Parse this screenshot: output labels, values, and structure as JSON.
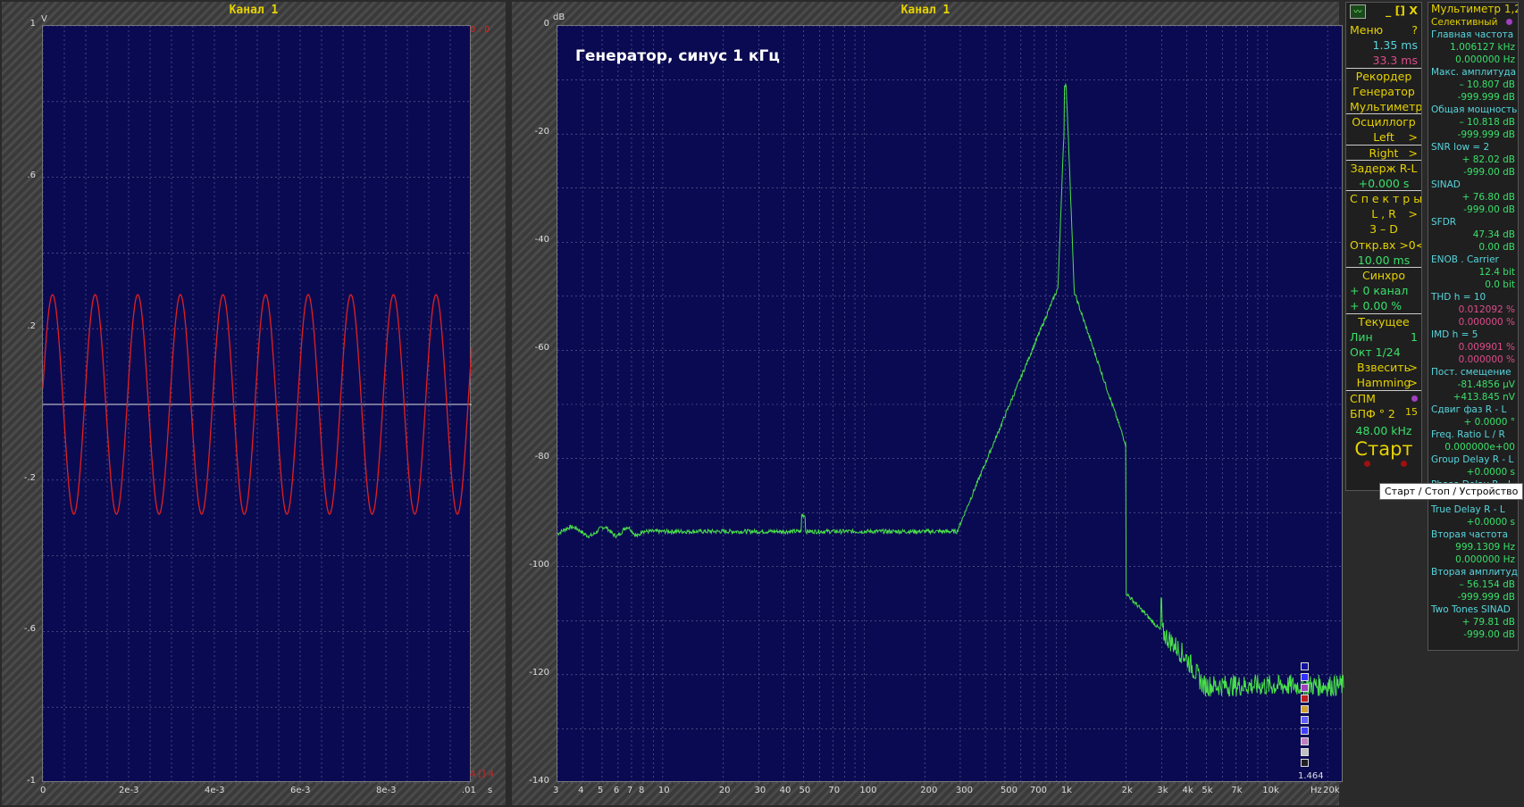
{
  "left_pane": {
    "title": "Канал 1",
    "unit_y": "V",
    "unit_x": "s",
    "y_ticks": [
      "1",
      ".6",
      ".2",
      "-.2",
      "-.6",
      "-1"
    ],
    "x_ticks": [
      "0",
      "2e-3",
      "4e-3",
      "6e-3",
      "8e-3",
      ".01"
    ],
    "corner_top": "0 : 0",
    "corner_bottom": "4 [] 4"
  },
  "right_pane": {
    "title": "Канал 1",
    "unit_y": "dB",
    "unit_x": "Hz",
    "annotation": "Генератор, синус 1 кГц",
    "scale_value": "1.464",
    "y_ticks": [
      "0",
      "-20",
      "-40",
      "-60",
      "-80",
      "-100",
      "-120",
      "-140"
    ],
    "x_ticks": [
      "3",
      "4",
      "5",
      "6",
      "7",
      "8",
      "10",
      "20",
      "30",
      "40",
      "50",
      "70",
      "100",
      "200",
      "300",
      "500",
      "700",
      "1k",
      "2k",
      "3k",
      "4k",
      "5k",
      "7k",
      "10k",
      "20k"
    ]
  },
  "menu": {
    "win_buttons": "_ [] X",
    "menu_label": "Меню",
    "help": "?",
    "t1": "1.35 ms",
    "t2": "33.3 ms",
    "recorder": "Рекордер",
    "generator": "Генератор",
    "multimeter": "Мультиметр",
    "oscilloscope": "Осциллогр",
    "left": "Left",
    "right": "Right",
    "delay_label": "Задерж  R-L",
    "delay_value": "+0.000  s",
    "spectra": "С п е к т р ы",
    "lr": "L , R",
    "three_d": "3 – D",
    "open_in": "Откр.вх >0<",
    "open_val": "10.00 ms",
    "sync": "Синхро",
    "sync_ch": "+  0 канал",
    "sync_pct": "+  0.00 %",
    "current": "Текущее",
    "lin": "Лин",
    "lin_v": "1",
    "oct": "Окт  1/24",
    "weigh": "Взвесить",
    "window": "Hamming",
    "psd": "СПМ",
    "fft": "БПФ ° 2",
    "fft_pow": "15",
    "rate": "48.00 kHz",
    "start": "Старт",
    "chev": ">"
  },
  "meter": {
    "title": "Мультиметр 1,2",
    "selective": "Селективный",
    "rows": [
      [
        "h",
        "Главная частота"
      ],
      [
        "v",
        "1.006127 kHz"
      ],
      [
        "v",
        "0.000000  Hz"
      ],
      [
        "h",
        "Макс. амплитуда"
      ],
      [
        "v",
        "– 10.807 dB"
      ],
      [
        "v",
        "-999.999 dB"
      ],
      [
        "h",
        "Общая мощность"
      ],
      [
        "v",
        "– 10.818 dB"
      ],
      [
        "v",
        "-999.999 dB"
      ],
      [
        "h",
        "SNR      low =  2"
      ],
      [
        "v",
        "+ 82.02 dB"
      ],
      [
        "v",
        "-999.00 dB"
      ],
      [
        "h",
        "SINAD"
      ],
      [
        "v",
        "+ 76.80 dB"
      ],
      [
        "v",
        "-999.00 dB"
      ],
      [
        "h",
        "SFDR"
      ],
      [
        "v",
        "47.34 dB"
      ],
      [
        "v",
        "0.00 dB"
      ],
      [
        "h",
        "ENOB . Carrier"
      ],
      [
        "v",
        "12.4 bit"
      ],
      [
        "v",
        "0.0 bit"
      ],
      [
        "h",
        "THD       h =  10"
      ],
      [
        "p",
        "0.012092 %"
      ],
      [
        "p",
        "0.000000 %"
      ],
      [
        "h",
        "IMD        h =   5"
      ],
      [
        "p",
        "0.009901 %"
      ],
      [
        "p",
        "0.000000 %"
      ],
      [
        "h",
        "Пост. смещение"
      ],
      [
        "v",
        "-81.4856 µV"
      ],
      [
        "v",
        "+413.845 nV"
      ],
      [
        "h",
        "Сдвиг фаз R - L"
      ],
      [
        "v",
        "+   0.0000 °"
      ],
      [
        "h",
        "Freq. Ratio  L / R"
      ],
      [
        "v",
        "0.000000e+00"
      ],
      [
        "h",
        "Group Delay R - L"
      ],
      [
        "v",
        "+0.0000  s"
      ],
      [
        "h",
        "Phase Delay R - L"
      ],
      [
        "v",
        "+0.0000  s"
      ],
      [
        "h",
        "True  Delay R - L"
      ],
      [
        "v",
        "+0.0000  s"
      ],
      [
        "h",
        "Вторая частота"
      ],
      [
        "v",
        "999.1309  Hz"
      ],
      [
        "v",
        "0.000000  Hz"
      ],
      [
        "h",
        "Вторая амплитуда"
      ],
      [
        "v",
        "– 56.154 dB"
      ],
      [
        "v",
        "-999.999 dB"
      ],
      [
        "h",
        "Two Tones SINAD"
      ],
      [
        "v",
        "+ 79.81 dB"
      ],
      [
        "v",
        "-999.00 dB"
      ]
    ]
  },
  "tooltip": "Старт / Стоп / Устройство",
  "colors": {
    "plot_bg": "#0a0a52",
    "sine": "#e02020",
    "spectrum": "#49e049",
    "label": "#e6d200"
  }
}
